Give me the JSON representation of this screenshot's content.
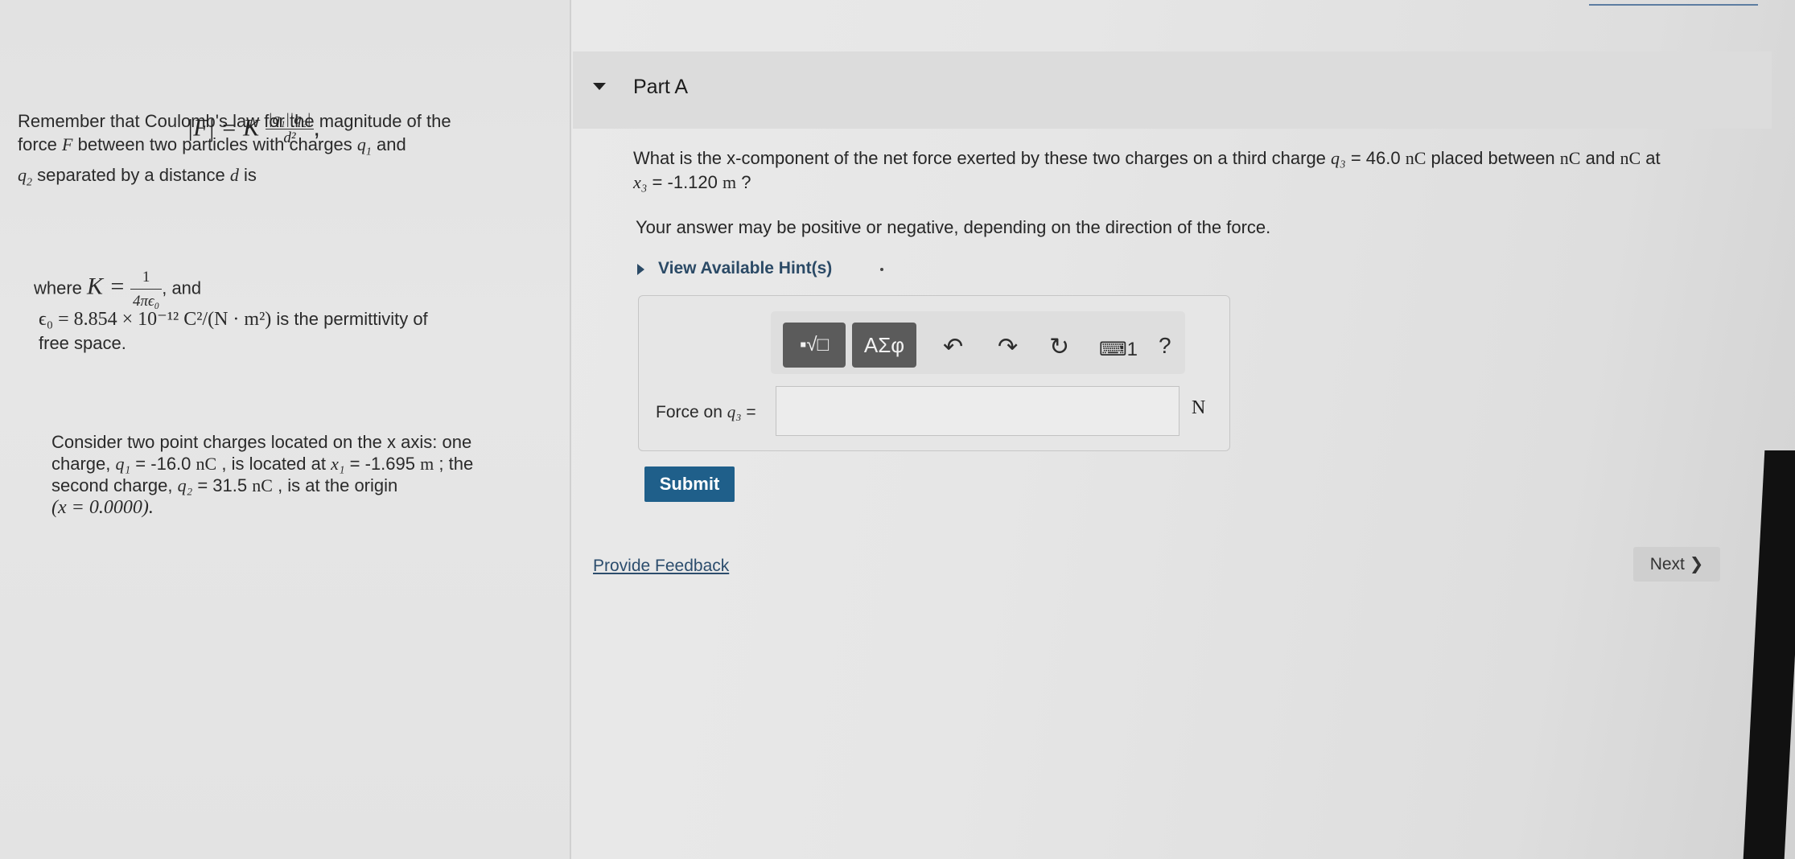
{
  "info": {
    "intro": "Remember that Coulomb's law for the magnitude of the",
    "force_line_a": "force",
    "force_var": "F",
    "force_line_b": "between two particles with charges",
    "q1_var": "q",
    "q1_sub": "1",
    "and_word": "and",
    "q2_var": "q",
    "q2_sub": "2",
    "sep_text": "separated by a distance",
    "d_var": "d",
    "is_word": "is",
    "formula_lhs": "|F| = K",
    "formula_num": "|q₁||q₂|",
    "formula_den": "d²",
    "formula_comma": ",",
    "where_text": "where",
    "k_eq": "K =",
    "k_num": "1",
    "k_den": "4πϵ₀",
    "k_and": ", and",
    "eps_expr": "ϵ₀ = 8.854 × 10⁻¹² C²/(N · m²)",
    "eps_desc": "is the permittivity of",
    "free_space": "free space.",
    "consider_1": "Consider two point charges located on the x axis: one",
    "consider_2_a": "charge,",
    "consider_2_q": "q₁",
    "consider_2_b": "= -16.0",
    "consider_2_unit": "nC",
    "consider_2_c": ", is located at",
    "consider_2_x": "x₁",
    "consider_2_d": "= -1.695",
    "consider_2_m": "m",
    "consider_2_e": "; the",
    "consider_3_a": "second charge,",
    "consider_3_q": "q₂",
    "consider_3_b": "= 31.5",
    "consider_3_unit": "nC",
    "consider_3_c": ", is at the origin",
    "consider_4": "(x = 0.0000)."
  },
  "part": {
    "title": "Part A",
    "question_a": "What is the x-component of the net force exerted by these two charges on a third charge",
    "question_q3": "q₃",
    "question_b": "= 46.0",
    "question_unit1": "nC",
    "question_c": "placed between",
    "question_unit2": "nC",
    "question_d": "and",
    "question_unit3": "nC",
    "question_e": "at",
    "question_x3": "x₃",
    "question_f": "= -1.120",
    "question_m": "m",
    "question_g": "?",
    "note": "Your answer may be positive or negative, depending on the direction of the force.",
    "hint_label": "View Available Hint(s)"
  },
  "toolbar": {
    "templates_label": "▪√□",
    "greek_label": "ΑΣφ",
    "undo_icon": "↶",
    "redo_icon": "↷",
    "reset_icon": "↻",
    "keyboard_label": "⌨1",
    "help_label": "?"
  },
  "answer": {
    "label_text": "Force on",
    "label_var": "q₃",
    "label_eq": "=",
    "value": "",
    "unit": "N"
  },
  "actions": {
    "submit": "Submit",
    "feedback": "Provide Feedback",
    "next": "Next ❯"
  }
}
